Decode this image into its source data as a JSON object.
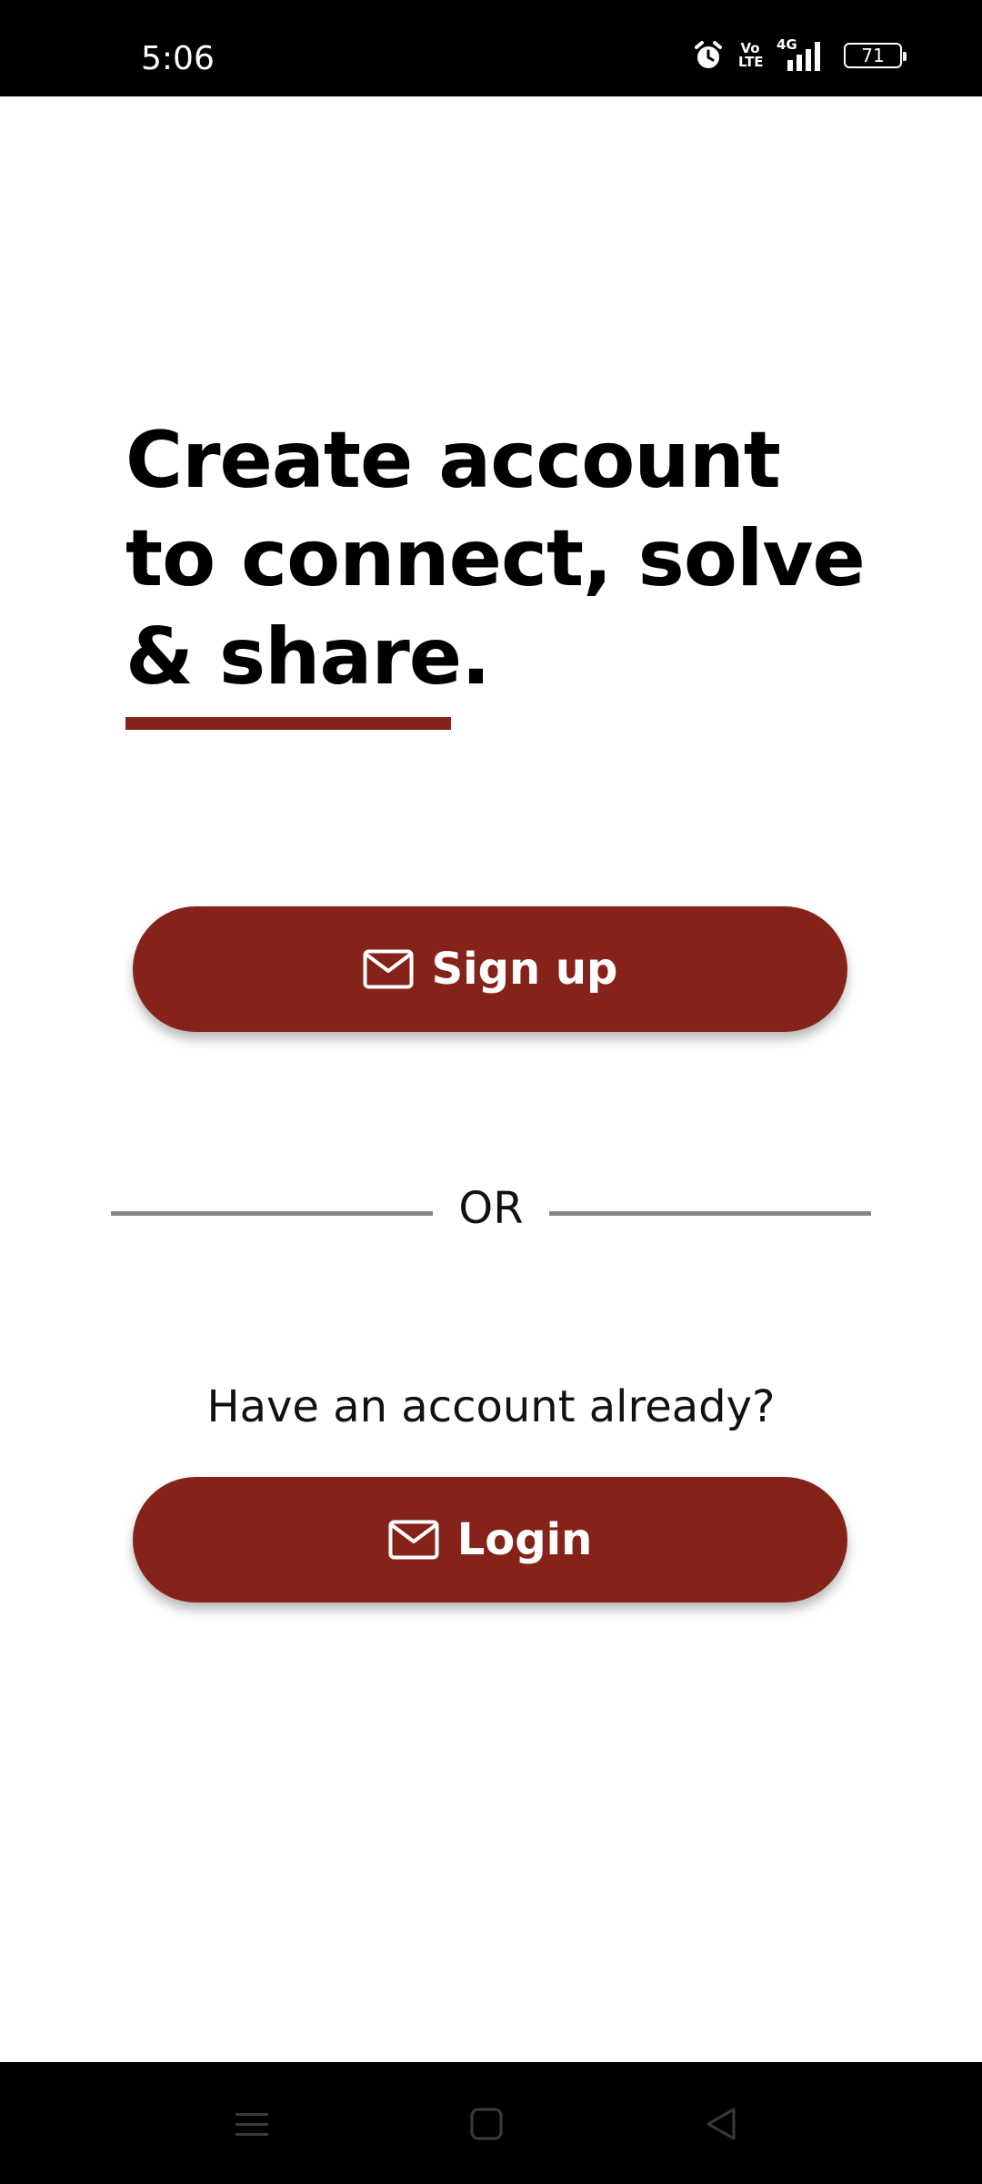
{
  "status_bar": {
    "time": "5:06",
    "icons": [
      "alarm-icon",
      "volte-icon",
      "signal-4g-icon",
      "battery-icon"
    ],
    "volte_top": "Vo",
    "volte_bottom": "LTE",
    "network": "4G",
    "battery_level": "71"
  },
  "headline": {
    "line1": "Create account",
    "line2": "to connect, solve",
    "line3": "& share."
  },
  "signup_button": {
    "label": "Sign up",
    "icon": "mail-icon"
  },
  "divider": {
    "text": "OR"
  },
  "login_prompt": "Have an account already?",
  "login_button": {
    "label": "Login",
    "icon": "mail-icon"
  },
  "nav_bar": {
    "icons": [
      "menu-icon",
      "home-square-icon",
      "back-triangle-icon"
    ]
  },
  "colors": {
    "accent": "#85231a",
    "background": "#ffffff",
    "text": "#000000",
    "divider": "#888888"
  }
}
